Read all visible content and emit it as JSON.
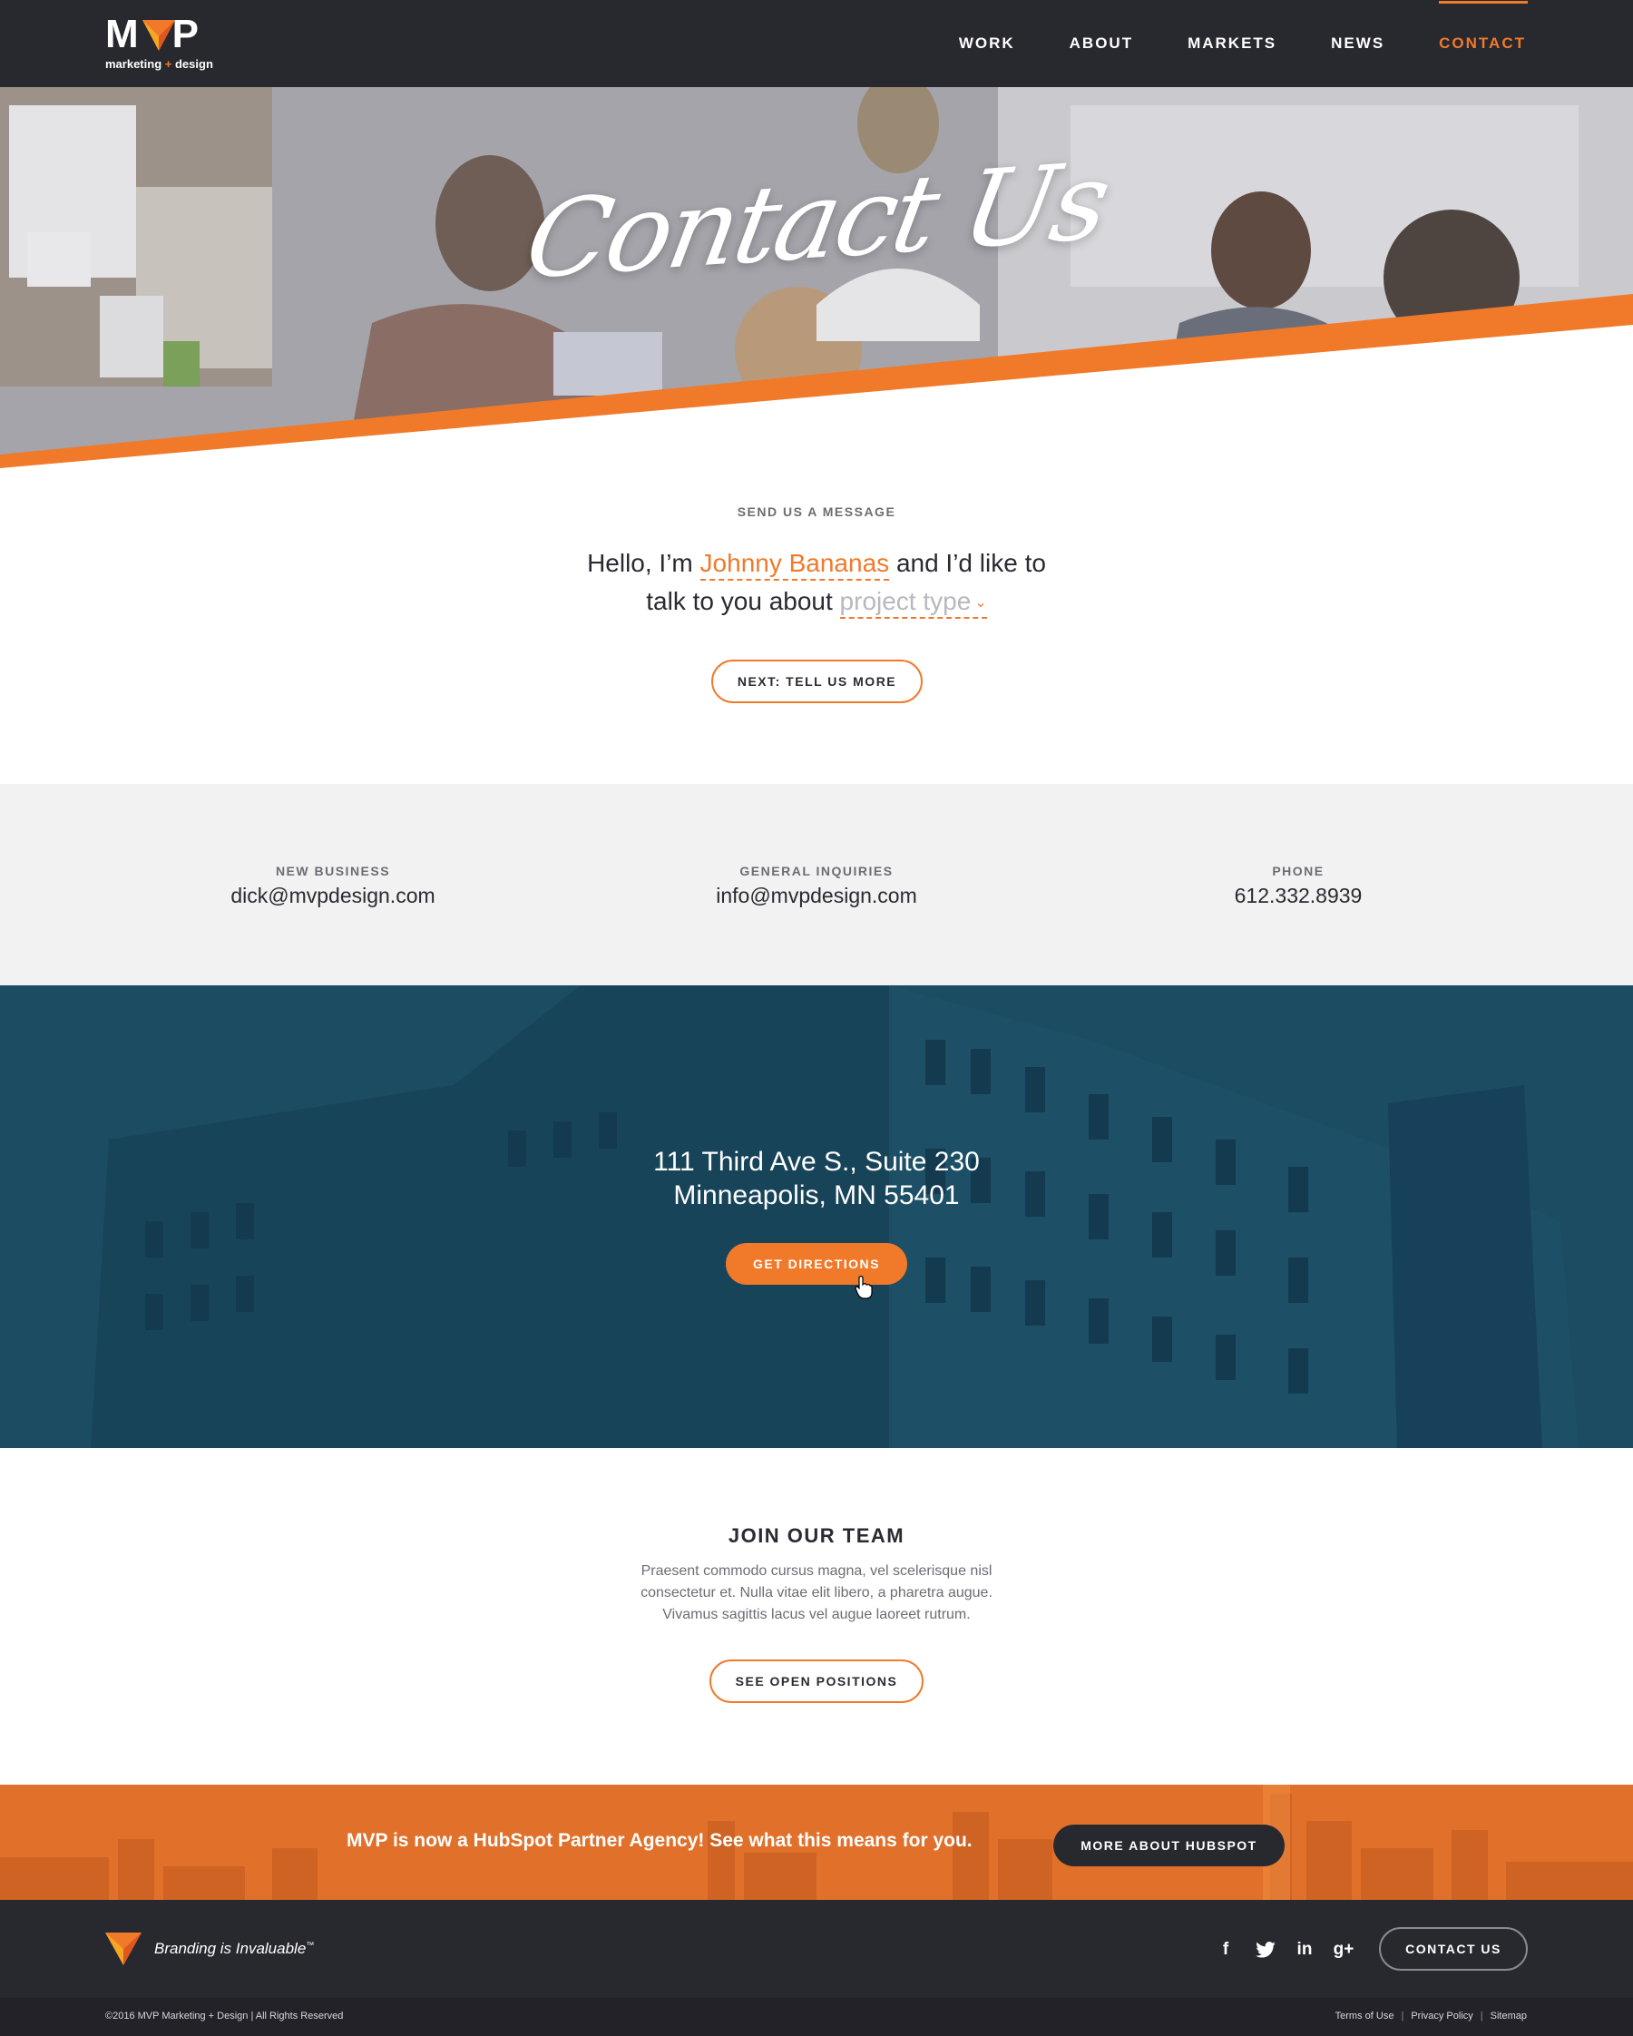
{
  "brand": {
    "logo_text": "MVP",
    "logo_tagline_left": "marketing",
    "logo_tagline_plus": "+",
    "logo_tagline_right": "design",
    "accent_color": "#f07a2a",
    "dark_color": "#28282f"
  },
  "nav": {
    "items": [
      {
        "label": "WORK"
      },
      {
        "label": "ABOUT"
      },
      {
        "label": "MARKETS"
      },
      {
        "label": "NEWS"
      },
      {
        "label": "CONTACT",
        "active": true
      }
    ]
  },
  "hero": {
    "title": "Contact Us"
  },
  "message_form": {
    "eyebrow": "SEND US A MESSAGE",
    "sentence_part1": "Hello, I’m",
    "name_value": "Johnny Bananas",
    "sentence_part2": "and I’d like to",
    "sentence_part3": "talk to you about",
    "project_placeholder": "project type",
    "next_button": "NEXT: TELL US MORE"
  },
  "contact_info": [
    {
      "label": "NEW BUSINESS",
      "value": "dick@mvpdesign.com"
    },
    {
      "label": "GENERAL INQUIRIES",
      "value": "info@mvpdesign.com"
    },
    {
      "label": "PHONE",
      "value": "612.332.8939"
    }
  ],
  "address": {
    "line1": "111 Third Ave S., Suite 230",
    "line2": "Minneapolis, MN 55401",
    "button": "GET DIRECTIONS"
  },
  "join": {
    "title": "JOIN OUR TEAM",
    "body_line1": "Praesent commodo cursus magna, vel scelerisque nisl",
    "body_line2": "consectetur et. Nulla vitae elit libero, a pharetra augue.",
    "body_line3": "Vivamus sagittis lacus vel augue laoreet rutrum.",
    "button": "SEE OPEN POSITIONS"
  },
  "hubspot": {
    "text": "MVP is now a HubSpot Partner Agency! See what this means for you.",
    "button": "MORE ABOUT HUBSPOT"
  },
  "footer": {
    "tagline": "Branding is Invaluable",
    "tagline_mark": "™",
    "social": [
      {
        "icon": "facebook-icon",
        "glyph": "f"
      },
      {
        "icon": "twitter-icon",
        "glyph": "🐦"
      },
      {
        "icon": "linkedin-icon",
        "glyph": "in"
      },
      {
        "icon": "google-plus-icon",
        "glyph": "g+"
      }
    ],
    "contact_button": "CONTACT US",
    "copyright": "©2016 MVP Marketing + Design | All Rights Reserved",
    "links": [
      {
        "label": "Terms of Use"
      },
      {
        "label": "Privacy Policy"
      },
      {
        "label": "Sitemap"
      }
    ]
  }
}
